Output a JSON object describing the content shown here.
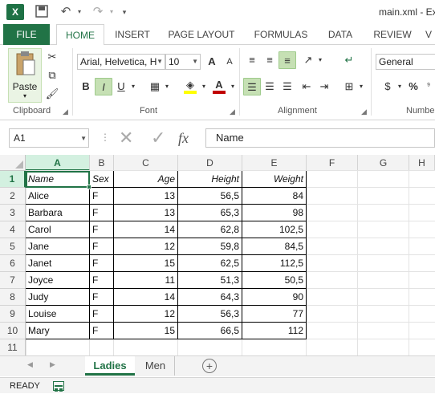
{
  "app": {
    "logo": "X",
    "title": "main.xml - Ex"
  },
  "quick_access": {
    "save_icon": "save-icon",
    "undo_icon": "undo-icon",
    "redo_icon": "redo-icon",
    "customize_icon": "customize-icon"
  },
  "ribbon_tabs": [
    "FILE",
    "HOME",
    "INSERT",
    "PAGE LAYOUT",
    "FORMULAS",
    "DATA",
    "REVIEW",
    "V"
  ],
  "ribbon": {
    "paste_label": "Paste",
    "font_name": "Arial, Helvetica, H",
    "font_size": "10",
    "number_format": "General",
    "groups": {
      "clipboard": "Clipboard",
      "font": "Font",
      "alignment": "Alignment",
      "number": "Numbe"
    },
    "bold": "B",
    "italic": "I",
    "underline": "U",
    "grow_font": "A",
    "shrink_font": "A",
    "currency": "$",
    "percent": "%"
  },
  "formula_bar": {
    "name_box": "A1",
    "cancel": "✕",
    "enter": "✓",
    "fx": "fx",
    "content": "Name"
  },
  "columns": [
    "A",
    "B",
    "C",
    "D",
    "E",
    "F",
    "G",
    "H"
  ],
  "rows": [
    "1",
    "2",
    "3",
    "4",
    "5",
    "6",
    "7",
    "8",
    "9",
    "10",
    "11"
  ],
  "table": {
    "headers": [
      "Name",
      "Sex",
      "Age",
      "Height",
      "Weight"
    ],
    "data": [
      [
        "Alice",
        "F",
        "13",
        "56,5",
        "84"
      ],
      [
        "Barbara",
        "F",
        "13",
        "65,3",
        "98"
      ],
      [
        "Carol",
        "F",
        "14",
        "62,8",
        "102,5"
      ],
      [
        "Jane",
        "F",
        "12",
        "59,8",
        "84,5"
      ],
      [
        "Janet",
        "F",
        "15",
        "62,5",
        "112,5"
      ],
      [
        "Joyce",
        "F",
        "11",
        "51,3",
        "50,5"
      ],
      [
        "Judy",
        "F",
        "14",
        "64,3",
        "90"
      ],
      [
        "Louise",
        "F",
        "12",
        "56,3",
        "77"
      ],
      [
        "Mary",
        "F",
        "15",
        "66,5",
        "112"
      ]
    ]
  },
  "selected_cell": "A1",
  "sheets": [
    "Ladies",
    "Men"
  ],
  "active_sheet": "Ladies",
  "status": {
    "text": "READY"
  },
  "colors": {
    "accent": "#217346",
    "selected_button": "#c6e0b4",
    "font_color": "#c00000",
    "highlight": "#ffff00"
  }
}
